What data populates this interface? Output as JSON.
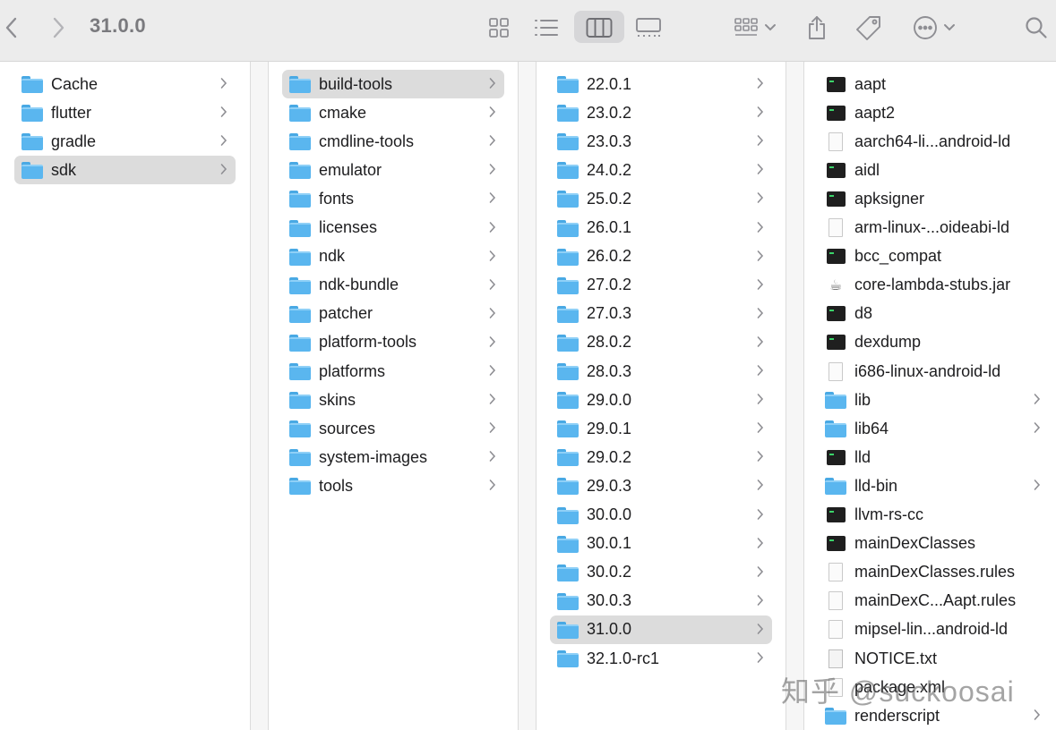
{
  "window": {
    "title": "31.0.0"
  },
  "toolbar": {
    "back_icon": "chevron-left-icon",
    "forward_icon": "chevron-right-icon",
    "active_view": "columns"
  },
  "columns": [
    {
      "items": [
        {
          "label": "Cache",
          "type": "folder",
          "has_children": true,
          "selected": false
        },
        {
          "label": "flutter",
          "type": "folder",
          "has_children": true,
          "selected": false
        },
        {
          "label": "gradle",
          "type": "folder",
          "has_children": true,
          "selected": false
        },
        {
          "label": "sdk",
          "type": "folder",
          "has_children": true,
          "selected": true
        }
      ]
    },
    {
      "items": [
        {
          "label": "build-tools",
          "type": "folder",
          "has_children": true,
          "selected": true
        },
        {
          "label": "cmake",
          "type": "folder",
          "has_children": true,
          "selected": false
        },
        {
          "label": "cmdline-tools",
          "type": "folder",
          "has_children": true,
          "selected": false
        },
        {
          "label": "emulator",
          "type": "folder",
          "has_children": true,
          "selected": false
        },
        {
          "label": "fonts",
          "type": "folder",
          "has_children": true,
          "selected": false
        },
        {
          "label": "licenses",
          "type": "folder",
          "has_children": true,
          "selected": false
        },
        {
          "label": "ndk",
          "type": "folder",
          "has_children": true,
          "selected": false
        },
        {
          "label": "ndk-bundle",
          "type": "folder",
          "has_children": true,
          "selected": false
        },
        {
          "label": "patcher",
          "type": "folder",
          "has_children": true,
          "selected": false
        },
        {
          "label": "platform-tools",
          "type": "folder",
          "has_children": true,
          "selected": false
        },
        {
          "label": "platforms",
          "type": "folder",
          "has_children": true,
          "selected": false
        },
        {
          "label": "skins",
          "type": "folder",
          "has_children": true,
          "selected": false
        },
        {
          "label": "sources",
          "type": "folder",
          "has_children": true,
          "selected": false
        },
        {
          "label": "system-images",
          "type": "folder",
          "has_children": true,
          "selected": false
        },
        {
          "label": "tools",
          "type": "folder",
          "has_children": true,
          "selected": false
        }
      ]
    },
    {
      "items": [
        {
          "label": "22.0.1",
          "type": "folder",
          "has_children": true,
          "selected": false
        },
        {
          "label": "23.0.2",
          "type": "folder",
          "has_children": true,
          "selected": false
        },
        {
          "label": "23.0.3",
          "type": "folder",
          "has_children": true,
          "selected": false
        },
        {
          "label": "24.0.2",
          "type": "folder",
          "has_children": true,
          "selected": false
        },
        {
          "label": "25.0.2",
          "type": "folder",
          "has_children": true,
          "selected": false
        },
        {
          "label": "26.0.1",
          "type": "folder",
          "has_children": true,
          "selected": false
        },
        {
          "label": "26.0.2",
          "type": "folder",
          "has_children": true,
          "selected": false
        },
        {
          "label": "27.0.2",
          "type": "folder",
          "has_children": true,
          "selected": false
        },
        {
          "label": "27.0.3",
          "type": "folder",
          "has_children": true,
          "selected": false
        },
        {
          "label": "28.0.2",
          "type": "folder",
          "has_children": true,
          "selected": false
        },
        {
          "label": "28.0.3",
          "type": "folder",
          "has_children": true,
          "selected": false
        },
        {
          "label": "29.0.0",
          "type": "folder",
          "has_children": true,
          "selected": false
        },
        {
          "label": "29.0.1",
          "type": "folder",
          "has_children": true,
          "selected": false
        },
        {
          "label": "29.0.2",
          "type": "folder",
          "has_children": true,
          "selected": false
        },
        {
          "label": "29.0.3",
          "type": "folder",
          "has_children": true,
          "selected": false
        },
        {
          "label": "30.0.0",
          "type": "folder",
          "has_children": true,
          "selected": false
        },
        {
          "label": "30.0.1",
          "type": "folder",
          "has_children": true,
          "selected": false
        },
        {
          "label": "30.0.2",
          "type": "folder",
          "has_children": true,
          "selected": false
        },
        {
          "label": "30.0.3",
          "type": "folder",
          "has_children": true,
          "selected": false
        },
        {
          "label": "31.0.0",
          "type": "folder",
          "has_children": true,
          "selected": true
        },
        {
          "label": "32.1.0-rc1",
          "type": "folder",
          "has_children": true,
          "selected": false
        }
      ]
    },
    {
      "items": [
        {
          "label": "aapt",
          "type": "exec",
          "has_children": false,
          "selected": false
        },
        {
          "label": "aapt2",
          "type": "exec",
          "has_children": false,
          "selected": false
        },
        {
          "label": "aarch64-li...android-ld",
          "type": "doc",
          "has_children": false,
          "selected": false
        },
        {
          "label": "aidl",
          "type": "exec",
          "has_children": false,
          "selected": false
        },
        {
          "label": "apksigner",
          "type": "exec",
          "has_children": false,
          "selected": false
        },
        {
          "label": "arm-linux-...oideabi-ld",
          "type": "doc",
          "has_children": false,
          "selected": false
        },
        {
          "label": "bcc_compat",
          "type": "exec",
          "has_children": false,
          "selected": false
        },
        {
          "label": "core-lambda-stubs.jar",
          "type": "jar",
          "has_children": false,
          "selected": false
        },
        {
          "label": "d8",
          "type": "exec",
          "has_children": false,
          "selected": false
        },
        {
          "label": "dexdump",
          "type": "exec",
          "has_children": false,
          "selected": false
        },
        {
          "label": "i686-linux-android-ld",
          "type": "doc",
          "has_children": false,
          "selected": false
        },
        {
          "label": "lib",
          "type": "folder",
          "has_children": true,
          "selected": false
        },
        {
          "label": "lib64",
          "type": "folder",
          "has_children": true,
          "selected": false
        },
        {
          "label": "lld",
          "type": "exec",
          "has_children": false,
          "selected": false
        },
        {
          "label": "lld-bin",
          "type": "folder",
          "has_children": true,
          "selected": false
        },
        {
          "label": "llvm-rs-cc",
          "type": "exec",
          "has_children": false,
          "selected": false
        },
        {
          "label": "mainDexClasses",
          "type": "exec",
          "has_children": false,
          "selected": false
        },
        {
          "label": "mainDexClasses.rules",
          "type": "doc",
          "has_children": false,
          "selected": false
        },
        {
          "label": "mainDexC...Aapt.rules",
          "type": "doc",
          "has_children": false,
          "selected": false
        },
        {
          "label": "mipsel-lin...android-ld",
          "type": "doc",
          "has_children": false,
          "selected": false
        },
        {
          "label": "NOTICE.txt",
          "type": "txt",
          "has_children": false,
          "selected": false
        },
        {
          "label": "package.xml",
          "type": "doc",
          "has_children": false,
          "selected": false
        },
        {
          "label": "renderscript",
          "type": "folder",
          "has_children": true,
          "selected": false
        }
      ]
    }
  ],
  "watermark": {
    "text": "知乎 @suckoosai"
  }
}
